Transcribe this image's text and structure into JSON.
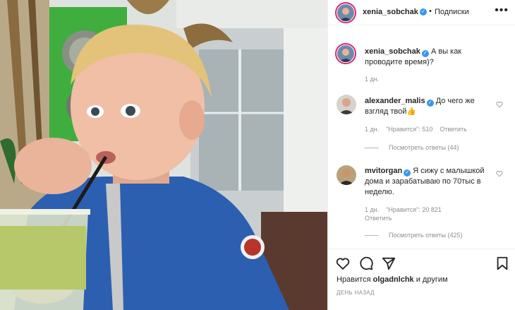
{
  "header": {
    "username": "xenia_sobchak",
    "dot": "•",
    "follow_label": "Подписки",
    "more_label": "•••"
  },
  "caption": {
    "username": "xenia_sobchak",
    "text": "А вы как проводите время)?",
    "time": "1 дн."
  },
  "comments": [
    {
      "username": "alexander_malis",
      "text": "До чего же взгляд твой👍",
      "time": "1 дн.",
      "likes": "\"Нравится\": 510",
      "reply_label": "Ответить",
      "view_replies": "Посмотреть ответы (44)"
    },
    {
      "username": "mvitorgan",
      "text": "Я сижу с малышкой дома и зарабатываю по 70тыс в неделю.",
      "time": "1 дн.",
      "likes": "\"Нравится\": 20 821",
      "reply_label": "Ответить",
      "view_replies": "Посмотреть ответы (425)"
    }
  ],
  "footer": {
    "likes_prefix": "Нравится",
    "likes_user": "olgadnlchk",
    "likes_suffix": "и другим",
    "date": "ДЕНЬ НАЗАД"
  },
  "colors": {
    "verified": "#3897f0",
    "story_ring": "#d62976",
    "muted": "#8e8e8e",
    "text": "#262626"
  },
  "icons": [
    "heart-icon",
    "comment-icon",
    "share-icon",
    "bookmark-icon",
    "verified-icon",
    "more-icon"
  ]
}
